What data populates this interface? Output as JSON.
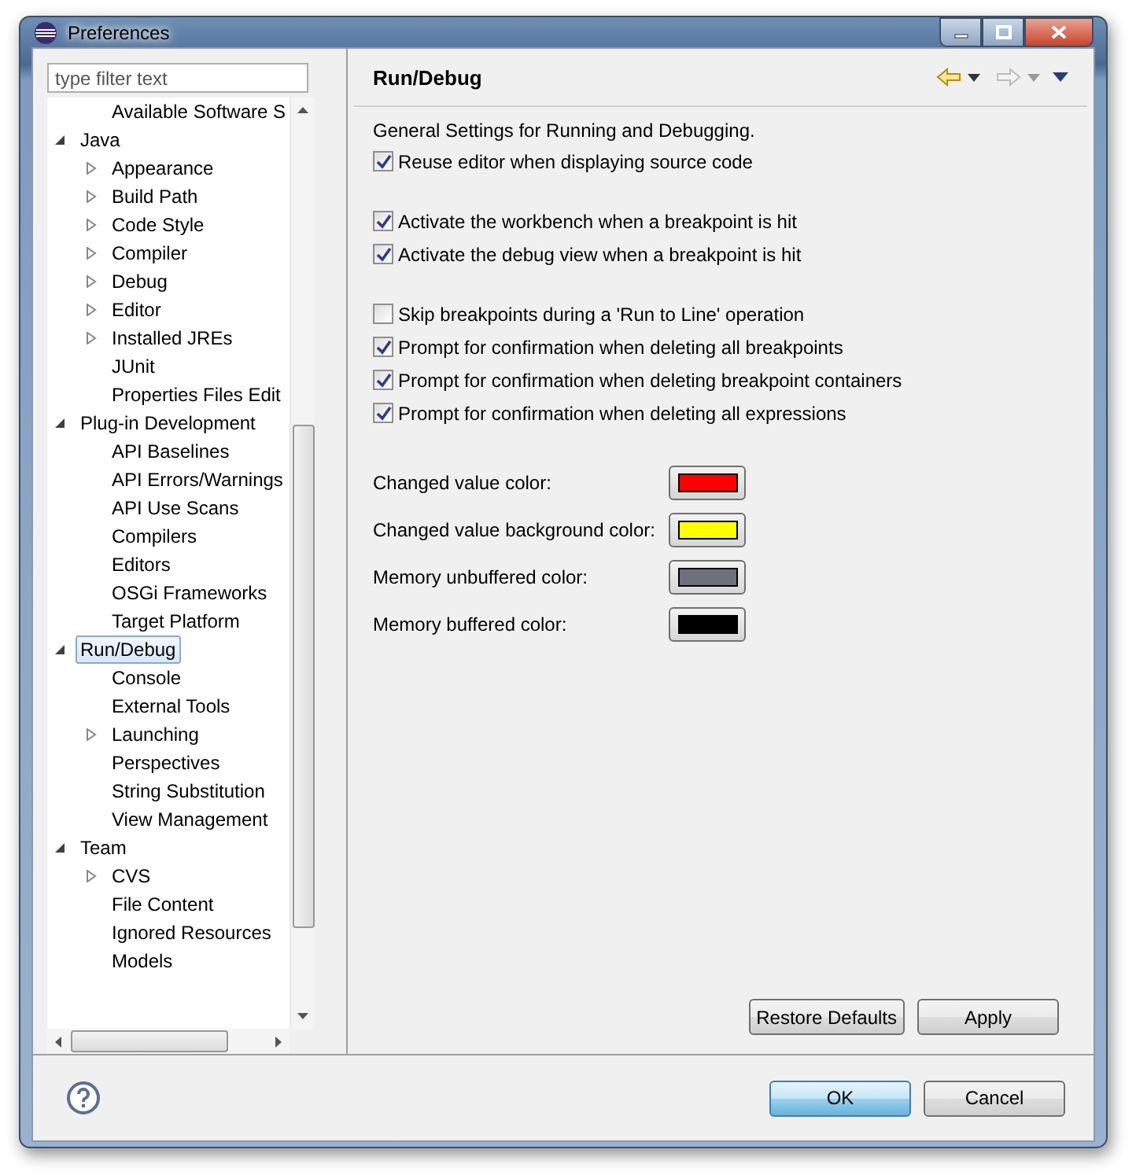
{
  "window": {
    "title": "Preferences"
  },
  "filter": {
    "placeholder": "type filter text"
  },
  "tree": [
    {
      "children": [
        {
          "label": "Available Software S",
          "selected": false
        }
      ]
    },
    {
      "label": "Java",
      "expanded": true,
      "selected": false,
      "children": [
        {
          "label": "Appearance",
          "expanded": false,
          "selected": false
        },
        {
          "label": "Build Path",
          "expanded": false,
          "selected": false
        },
        {
          "label": "Code Style",
          "expanded": false,
          "selected": false
        },
        {
          "label": "Compiler",
          "expanded": false,
          "selected": false
        },
        {
          "label": "Debug",
          "expanded": false,
          "selected": false
        },
        {
          "label": "Editor",
          "expanded": false,
          "selected": false
        },
        {
          "label": "Installed JREs",
          "expanded": false,
          "selected": false
        },
        {
          "label": "JUnit",
          "selected": false
        },
        {
          "label": "Properties Files Edit",
          "selected": false
        }
      ]
    },
    {
      "label": "Plug-in Development",
      "expanded": true,
      "selected": false,
      "children": [
        {
          "label": "API Baselines",
          "selected": false
        },
        {
          "label": "API Errors/Warnings",
          "selected": false
        },
        {
          "label": "API Use Scans",
          "selected": false
        },
        {
          "label": "Compilers",
          "selected": false
        },
        {
          "label": "Editors",
          "selected": false
        },
        {
          "label": "OSGi Frameworks",
          "selected": false
        },
        {
          "label": "Target Platform",
          "selected": false
        }
      ]
    },
    {
      "label": "Run/Debug",
      "expanded": true,
      "selected": true,
      "children": [
        {
          "label": "Console",
          "selected": false
        },
        {
          "label": "External Tools",
          "selected": false
        },
        {
          "label": "Launching",
          "expanded": false,
          "selected": false
        },
        {
          "label": "Perspectives",
          "selected": false
        },
        {
          "label": "String Substitution",
          "selected": false
        },
        {
          "label": "View Management",
          "selected": false
        }
      ]
    },
    {
      "label": "Team",
      "expanded": true,
      "selected": false,
      "children": [
        {
          "label": "CVS",
          "expanded": false,
          "selected": false
        },
        {
          "label": "File Content",
          "selected": false
        },
        {
          "label": "Ignored Resources",
          "selected": false
        },
        {
          "label": "Models",
          "selected": false
        }
      ]
    }
  ],
  "page": {
    "title": "Run/Debug",
    "description": "General Settings for Running and Debugging.",
    "option_groups": [
      [
        {
          "label": "Reuse editor when displaying source code",
          "checked": true
        }
      ],
      [
        {
          "label": "Activate the workbench when a breakpoint is hit",
          "checked": true
        },
        {
          "label": "Activate the debug view when a breakpoint is hit",
          "checked": true
        }
      ],
      [
        {
          "label": "Skip breakpoints during a 'Run to Line' operation",
          "checked": false
        },
        {
          "label": "Prompt for confirmation when deleting all breakpoints",
          "checked": true
        },
        {
          "label": "Prompt for confirmation when deleting breakpoint containers",
          "checked": true
        },
        {
          "label": "Prompt for confirmation when deleting all expressions",
          "checked": true
        }
      ]
    ],
    "colors": [
      {
        "label": "Changed value color:",
        "color": "#ff0000"
      },
      {
        "label": "Changed value background color:",
        "color": "#ffff00"
      },
      {
        "label": "Memory unbuffered color:",
        "color": "#6e7179"
      },
      {
        "label": "Memory buffered color:",
        "color": "#000000"
      }
    ]
  },
  "page_buttons": [
    {
      "label": "Restore Defaults"
    },
    {
      "label": "Apply"
    }
  ],
  "dialog_buttons": [
    {
      "label": "OK",
      "default": true
    },
    {
      "label": "Cancel",
      "default": false
    }
  ]
}
